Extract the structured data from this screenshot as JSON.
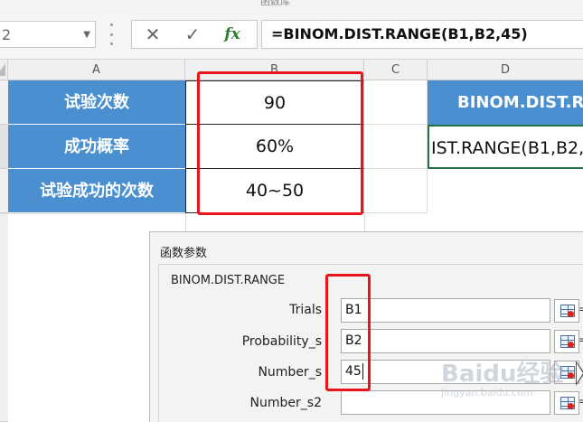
{
  "window": {
    "title_fragment": "函数库"
  },
  "formula_bar": {
    "name_box": "2",
    "cancel_glyph": "✕",
    "enter_glyph": "✓",
    "fx_label": "fx",
    "formula": "=BINOM.DIST.RANGE(B1,B2,45)"
  },
  "columns": [
    "A",
    "B",
    "C",
    "D"
  ],
  "sheet": {
    "rows": [
      {
        "label": "试验次数",
        "value": "90"
      },
      {
        "label": "成功概率",
        "value": "60%"
      },
      {
        "label": "试验成功的次数",
        "value": "40~50"
      }
    ],
    "d1": "BINOM.DIST.R",
    "d2": "IST.RANGE(B1,B2,"
  },
  "dialog": {
    "title": "函数参数",
    "function_name": "BINOM.DIST.RANGE",
    "args": [
      {
        "label": "Trials",
        "value": "B1"
      },
      {
        "label": "Probability_s",
        "value": "B2"
      },
      {
        "label": "Number_s",
        "value": "45"
      },
      {
        "label": "Number_s2",
        "value": ""
      }
    ],
    "side_marker": "="
  },
  "watermark": {
    "brand": "Baidu经验",
    "domain": "jingyan.baidu.com"
  },
  "colors": {
    "header_blue": "#4a8fd0",
    "highlight_red": "#e8161c",
    "select_green": "#217346"
  }
}
